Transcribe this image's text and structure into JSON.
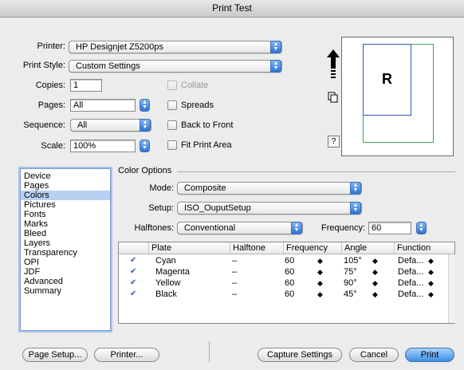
{
  "window": {
    "title": "Print Test"
  },
  "printer": {
    "label": "Printer:",
    "value": "HP Designjet Z5200ps"
  },
  "print_style": {
    "label": "Print Style:",
    "value": "Custom Settings"
  },
  "copies": {
    "label": "Copies:",
    "value": "1"
  },
  "pages": {
    "label": "Pages:",
    "value": "All"
  },
  "sequence": {
    "label": "Sequence:",
    "value": "All"
  },
  "scale": {
    "label": "Scale:",
    "value": "100%"
  },
  "checkboxes": {
    "collate": "Collate",
    "spreads": "Spreads",
    "back_to_front": "Back to Front",
    "fit_print_area": "Fit Print Area"
  },
  "preview": {
    "letter": "R",
    "help_label": "?"
  },
  "sidebar": {
    "items": [
      "Device",
      "Pages",
      "Colors",
      "Pictures",
      "Fonts",
      "Marks",
      "Bleed",
      "Layers",
      "Transparency",
      "OPI",
      "JDF",
      "Advanced",
      "Summary"
    ],
    "selected": "Colors"
  },
  "color_options": {
    "title": "Color Options",
    "mode": {
      "label": "Mode:",
      "value": "Composite"
    },
    "setup": {
      "label": "Setup:",
      "value": "ISO_OuputSetup"
    },
    "halftones": {
      "label": "Halftones:",
      "value": "Conventional"
    },
    "frequency": {
      "label": "Frequency:",
      "value": "60"
    }
  },
  "plate_table": {
    "headers": [
      "Plate",
      "Halftone",
      "Frequency",
      "Angle",
      "Function"
    ],
    "rows": [
      {
        "plate": "Cyan",
        "halftone": "–",
        "frequency": "60",
        "angle": "105°",
        "function": "Defa..."
      },
      {
        "plate": "Magenta",
        "halftone": "–",
        "frequency": "60",
        "angle": "75°",
        "function": "Defa..."
      },
      {
        "plate": "Yellow",
        "halftone": "–",
        "frequency": "60",
        "angle": "90°",
        "function": "Defa..."
      },
      {
        "plate": "Black",
        "halftone": "–",
        "frequency": "60",
        "angle": "45°",
        "function": "Defa..."
      }
    ]
  },
  "buttons": {
    "page_setup": "Page Setup...",
    "printer": "Printer...",
    "capture_settings": "Capture Settings",
    "cancel": "Cancel",
    "print": "Print"
  },
  "colors": {
    "accent": "#3c8ee8",
    "preview_page_green": "#3aa84a",
    "preview_page_blue": "#2c56b8"
  }
}
